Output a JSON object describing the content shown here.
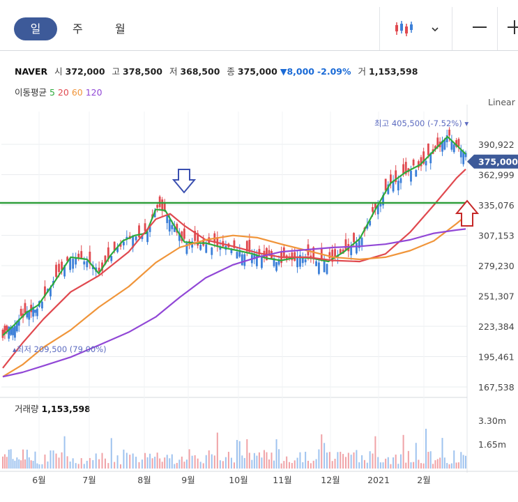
{
  "toolbar": {
    "periods": [
      "일",
      "주",
      "월"
    ],
    "active_period": "일",
    "chart_style_icon": "candlestick-icon",
    "dropdown_icon": "chevron-down-icon",
    "zoom_out_icon": "minus-icon",
    "zoom_in_icon": "plus-icon"
  },
  "quote": {
    "name": "NAVER",
    "open_label": "시",
    "open": "372,000",
    "high_label": "고",
    "high": "378,500",
    "low_label": "저",
    "low": "368,500",
    "close_label": "종",
    "close": "375,000",
    "change": "8,000",
    "change_pct": "-2.09%",
    "volume_label": "거",
    "volume": "1,153,598"
  },
  "moving_averages": {
    "label": "이동평균",
    "periods": [
      {
        "period": "5",
        "color": "#2eaa3c"
      },
      {
        "period": "20",
        "color": "#e0494f"
      },
      {
        "period": "60",
        "color": "#f0953a"
      },
      {
        "period": "120",
        "color": "#9147d6"
      }
    ]
  },
  "scale_mode": "Linear",
  "annotations": {
    "high_label": "최고",
    "high_value": "405,500 (-7.52%)",
    "low_label": "최저",
    "low_value": "209,500 (79.00%)",
    "current_price_tag": "375,000"
  },
  "volume_panel": {
    "label": "거래량",
    "value": "1,153,598",
    "ticks": [
      "3.30m",
      "1.65m"
    ]
  },
  "chart_data": {
    "type": "line",
    "title": "NAVER",
    "y_ticks": [
      "390,922",
      "362,999",
      "335,076",
      "307,153",
      "279,230",
      "251,307",
      "223,384",
      "195,461",
      "167,538"
    ],
    "x_ticks": [
      "6월",
      "7월",
      "8월",
      "9월",
      "10월",
      "11월",
      "12월",
      "2021",
      "2월"
    ],
    "ylim": [
      167538,
      405500
    ],
    "horizontal_line": 337000,
    "colors": {
      "up": "#e0494f",
      "down": "#3b7fd8",
      "grid": "#e9ecef",
      "hline": "#2e9e3a",
      "up_arrow": "#c62828",
      "down_arrow": "#3a4fb0"
    },
    "grid": true,
    "x_month_index": [
      0,
      1,
      2,
      3,
      4,
      5,
      6,
      7,
      8
    ],
    "series": [
      {
        "name": "5",
        "color": "#2eaa3c",
        "x": [
          0,
          0.3,
          0.6,
          0.9,
          1.2,
          1.5,
          1.8,
          2.0,
          2.2,
          2.4,
          2.6,
          2.8,
          3.0,
          3.2,
          3.4,
          3.6,
          3.8,
          4.0,
          4.3,
          4.6,
          4.9,
          5.2,
          5.5,
          5.8,
          6.1,
          6.4,
          6.7,
          7.0,
          7.3,
          7.6,
          7.9,
          8.2,
          8.5,
          8.8,
          9.0,
          9.2
        ],
        "y": [
          215000,
          225000,
          236000,
          243000,
          264000,
          287000,
          285000,
          272000,
          289000,
          302000,
          307000,
          309000,
          331000,
          330000,
          315000,
          301000,
          300000,
          300000,
          296000,
          293000,
          290000,
          286000,
          284000,
          287000,
          286000,
          283000,
          292000,
          304000,
          331000,
          355000,
          365000,
          372000,
          385000,
          398000,
          390000,
          382000
        ]
      },
      {
        "name": "20",
        "color": "#e0494f",
        "x": [
          0,
          0.5,
          1.0,
          1.5,
          2.0,
          2.5,
          3.0,
          3.3,
          3.6,
          4.0,
          4.5,
          5.0,
          5.5,
          6.0,
          6.5,
          7.0,
          7.5,
          8.0,
          8.5,
          9.0,
          9.2
        ],
        "y": [
          185000,
          208000,
          230000,
          255000,
          270000,
          292000,
          322000,
          327000,
          316000,
          303000,
          297000,
          291000,
          287000,
          287000,
          284000,
          283000,
          290000,
          310000,
          335000,
          360000,
          368000
        ]
      },
      {
        "name": "60",
        "color": "#f0953a",
        "x": [
          0,
          0.5,
          1.0,
          1.5,
          2.0,
          2.5,
          3.0,
          3.5,
          4.0,
          4.5,
          5.0,
          5.5,
          6.0,
          6.5,
          7.0,
          7.5,
          8.0,
          8.5,
          9.0,
          9.2
        ],
        "y": [
          177000,
          188000,
          204000,
          220000,
          241000,
          260000,
          282000,
          296000,
          303000,
          307000,
          305000,
          299000,
          293000,
          287000,
          285000,
          287000,
          293000,
          302000,
          318000,
          325000
        ]
      },
      {
        "name": "120",
        "color": "#9147d6",
        "x": [
          0,
          0.5,
          1.0,
          1.5,
          2.0,
          2.5,
          3.0,
          3.5,
          4.0,
          4.5,
          5.0,
          5.5,
          6.0,
          6.5,
          7.0,
          7.5,
          8.0,
          8.5,
          9.0,
          9.2
        ],
        "y": [
          177000,
          181000,
          187000,
          195000,
          206000,
          218000,
          232000,
          250000,
          268000,
          280000,
          287000,
          292000,
          294000,
          296000,
          297000,
          299000,
          303000,
          309000,
          312000,
          313000
        ]
      }
    ]
  }
}
